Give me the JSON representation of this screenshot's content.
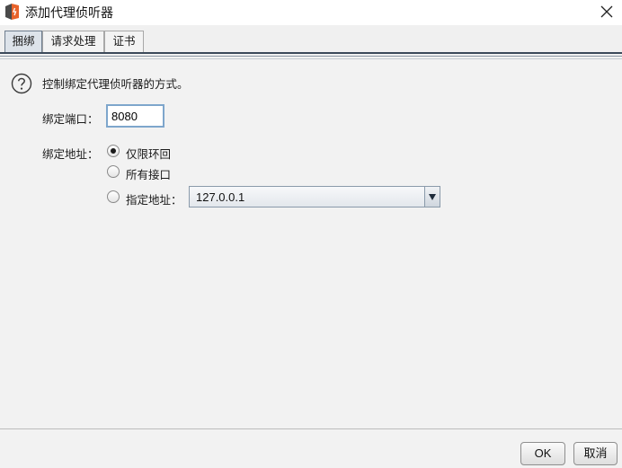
{
  "window": {
    "title": "添加代理侦听器",
    "accent_color": "#e8622a"
  },
  "tabs": [
    {
      "label": "捆绑",
      "active": true
    },
    {
      "label": "请求处理",
      "active": false
    },
    {
      "label": "证书",
      "active": false
    }
  ],
  "binding": {
    "description": "控制绑定代理侦听器的方式。",
    "port_label": "绑定端口：",
    "port_value": "8080",
    "address_label": "绑定地址：",
    "options": [
      {
        "label": "仅限环回",
        "selected": true
      },
      {
        "label": "所有接口",
        "selected": false
      },
      {
        "label": "指定地址：",
        "selected": false
      }
    ],
    "specific_address_value": "127.0.0.1"
  },
  "footer": {
    "ok_label": "OK",
    "cancel_label": "取消"
  }
}
